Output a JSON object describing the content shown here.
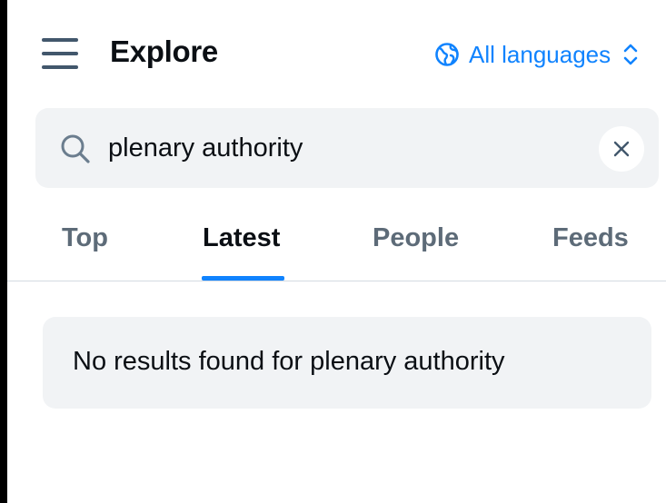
{
  "header": {
    "title": "Explore",
    "menu_icon": "hamburger-menu-icon",
    "language": {
      "label": "All languages",
      "icon": "globe-icon",
      "chevron": "up-down-chevron-icon",
      "color": "#1083fe"
    }
  },
  "search": {
    "value": "plenary authority",
    "placeholder": "",
    "search_icon": "search-icon",
    "clear_icon": "close-icon"
  },
  "tabs": [
    {
      "label": "Top",
      "active": false
    },
    {
      "label": "Latest",
      "active": true
    },
    {
      "label": "People",
      "active": false
    },
    {
      "label": "Feeds",
      "active": false
    }
  ],
  "results": {
    "empty_message": "No results found for plenary authority"
  },
  "colors": {
    "accent": "#1083fe",
    "text": "#0b0f14",
    "muted": "#5d6b78",
    "surface": "#f1f3f5"
  }
}
